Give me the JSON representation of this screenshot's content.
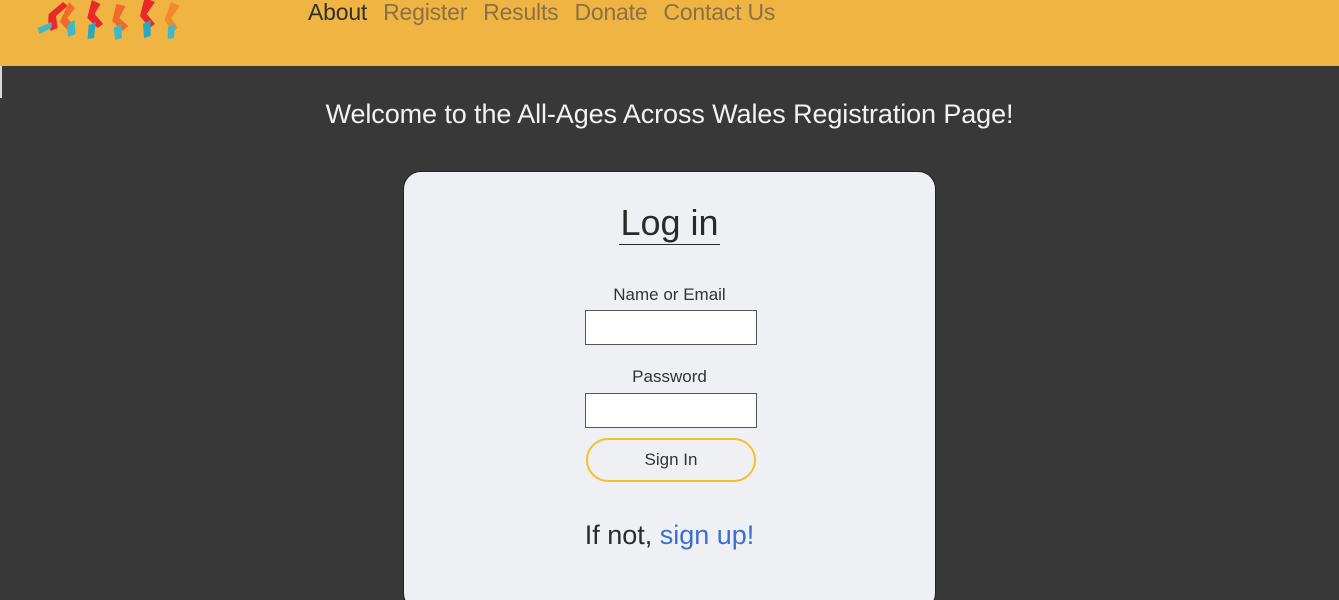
{
  "nav": {
    "items": [
      {
        "label": "About",
        "active": true
      },
      {
        "label": "Register",
        "active": false
      },
      {
        "label": "Results",
        "active": false
      },
      {
        "label": "Donate",
        "active": false
      },
      {
        "label": "Contact Us",
        "active": false
      }
    ]
  },
  "logo": {
    "icon": "runners-logo-icon"
  },
  "welcome": {
    "text": "Welcome to the All-Ages Across Wales Registration Page!"
  },
  "login": {
    "title": "Log in",
    "name_label": "Name or Email",
    "name_value": "",
    "password_label": "Password",
    "password_value": "",
    "sign_in_label": "Sign In",
    "signup_prefix": "If not, ",
    "signup_link": "sign up!"
  },
  "colors": {
    "header_bg": "#f0b443",
    "page_bg": "#383838",
    "card_bg": "#eff0f4",
    "button_border": "#f5c028",
    "link": "#3a6fd0"
  }
}
